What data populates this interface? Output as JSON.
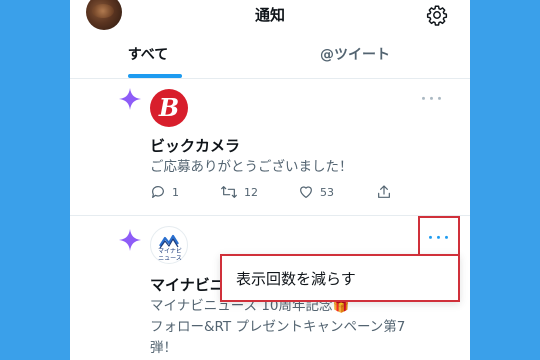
{
  "header": {
    "title": "通知"
  },
  "tabs": [
    {
      "label": "すべて",
      "active": true
    },
    {
      "label": "@ツイート",
      "active": false
    }
  ],
  "notifications": [
    {
      "logo_text": "B",
      "name": "ビックカメラ",
      "text": "ご応募ありがとうございました！",
      "replies": "1",
      "retweets": "12",
      "likes": "53",
      "more": "･･･"
    },
    {
      "logo_text": "マイナビ\nニュース",
      "name": "マイナビニ",
      "text_line1": "マイナビニュース 10周年記念🎁",
      "text_line2": "フォロー&RT プレゼントキャンペーン第7",
      "text_line3": "弾！",
      "more": "･･･"
    }
  ],
  "menu": {
    "item": "表示回数を減らす"
  },
  "colors": {
    "background": "#3aa0ea",
    "accent": "#1d9bf0",
    "highlight": "#d0303a",
    "spark": "#8e5cf7",
    "bic_red": "#d81e2c"
  }
}
